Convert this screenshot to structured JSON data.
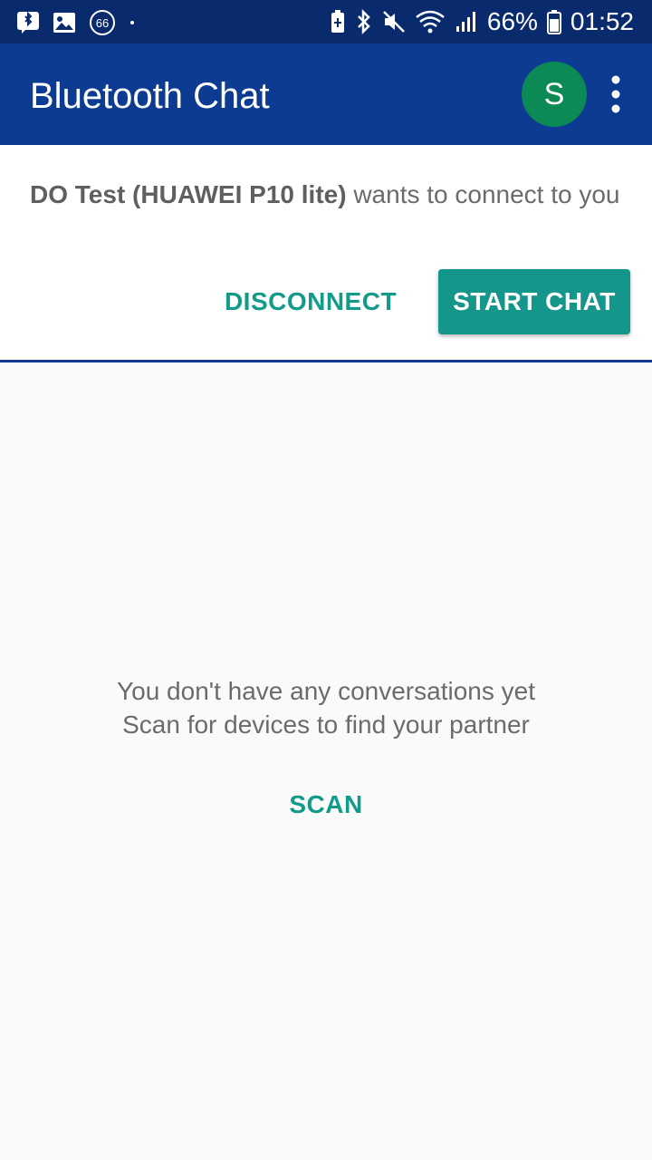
{
  "status_bar": {
    "left_icons": [
      "bluetooth-notification-icon",
      "image-notification-icon",
      "badge-66-icon",
      "dot-icon"
    ],
    "badge_text": "66",
    "battery_percent": "66%",
    "time": "01:52",
    "right_icons": [
      "battery-saver-icon",
      "bluetooth-icon",
      "mute-icon",
      "wifi-icon",
      "signal-icon",
      "battery-icon"
    ]
  },
  "app_bar": {
    "title": "Bluetooth Chat",
    "avatar_letter": "S",
    "menu_icon": "more-vert-icon"
  },
  "connection_request": {
    "device_name": "DO Test (HUAWEI P10 lite)",
    "message": " wants to connect to you",
    "disconnect_label": "DISCONNECT",
    "start_chat_label": "START CHAT"
  },
  "empty_state": {
    "line1": "You don't have any conversations yet",
    "line2": "Scan for devices to find your partner",
    "scan_label": "SCAN"
  },
  "colors": {
    "status_bar": "#0a2a6e",
    "app_bar": "#0d3b91",
    "accent": "#14968a",
    "avatar": "#0c8a55",
    "background": "#fafafa"
  }
}
